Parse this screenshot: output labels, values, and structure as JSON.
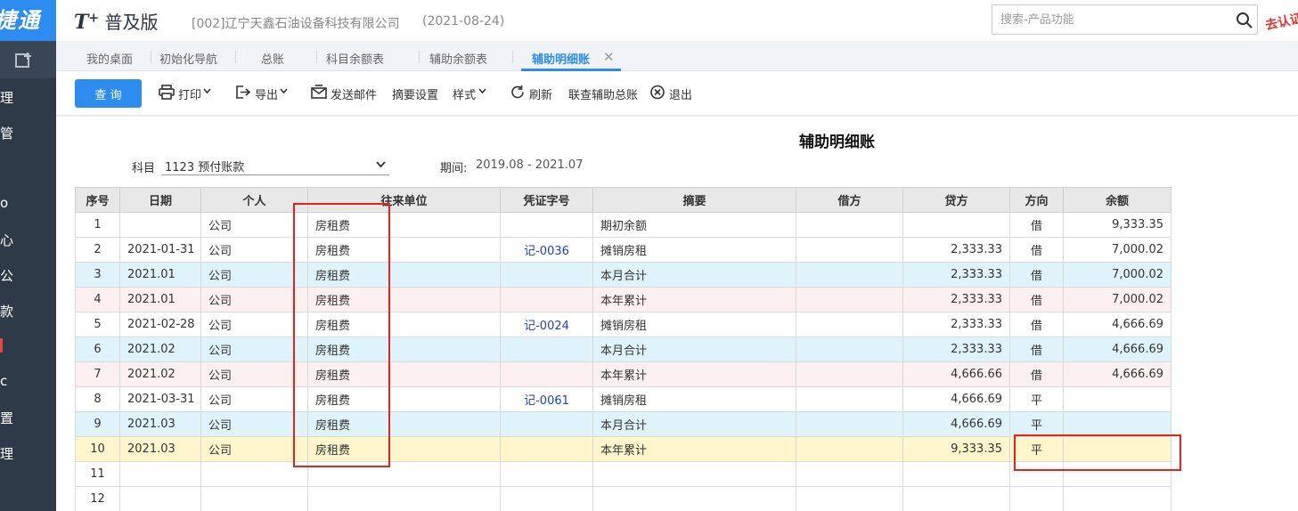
{
  "sidebar": {
    "brand": "捷通",
    "items": [
      "理",
      "管",
      "o",
      "心",
      "公",
      "款",
      "c",
      "置",
      "理"
    ],
    "marker_color": "#e84a3a"
  },
  "header": {
    "logo_mark": "T",
    "logo_plus": "+",
    "logo_text": "普及版",
    "company": "[002]辽宁天鑫石油设备科技有限公司",
    "date": "(2021-08-24)",
    "search_placeholder": "搜索-产品功能",
    "verify_text": "去认证"
  },
  "tabs": [
    {
      "label": "我的桌面",
      "active": false
    },
    {
      "label": "初始化导航",
      "active": false
    },
    {
      "label": "总账",
      "active": false
    },
    {
      "label": "科目余额表",
      "active": false
    },
    {
      "label": "辅助余额表",
      "active": false
    },
    {
      "label": "辅助明细账",
      "active": true
    }
  ],
  "toolbar": {
    "query": "查 询",
    "print": "打印",
    "export": "导出",
    "send_mail": "发送邮件",
    "summary_settings": "摘要设置",
    "style": "样式",
    "refresh": "刷新",
    "linked_general": "联查辅助总账",
    "exit": "退出"
  },
  "report": {
    "title": "辅助明细账",
    "subject_label": "科目",
    "subject_value": "1123 预付账款",
    "period_label": "期间:",
    "period_value": "2019.08 - 2021.07"
  },
  "table": {
    "columns": [
      "序号",
      "日期",
      "个人",
      "往来单位",
      "凭证字号",
      "摘要",
      "借方",
      "贷方",
      "方向",
      "余额"
    ],
    "rows": [
      {
        "no": "1",
        "date": "",
        "person": "公司",
        "unit": "房租费",
        "voucher": "",
        "summary": "期初余额",
        "debit": "",
        "credit": "",
        "dir": "借",
        "balance": "9,333.35",
        "style": "plain"
      },
      {
        "no": "2",
        "date": "2021-01-31",
        "person": "公司",
        "unit": "房租费",
        "voucher": "记-0036",
        "summary": "摊销房租",
        "debit": "",
        "credit": "2,333.33",
        "dir": "借",
        "balance": "7,000.02",
        "style": "plain"
      },
      {
        "no": "3",
        "date": "2021.01",
        "person": "公司",
        "unit": "房租费",
        "voucher": "",
        "summary": "本月合计",
        "debit": "",
        "credit": "2,333.33",
        "dir": "借",
        "balance": "7,000.02",
        "style": "blue"
      },
      {
        "no": "4",
        "date": "2021.01",
        "person": "公司",
        "unit": "房租费",
        "voucher": "",
        "summary": "本年累计",
        "debit": "",
        "credit": "2,333.33",
        "dir": "借",
        "balance": "7,000.02",
        "style": "pink"
      },
      {
        "no": "5",
        "date": "2021-02-28",
        "person": "公司",
        "unit": "房租费",
        "voucher": "记-0024",
        "summary": "摊销房租",
        "debit": "",
        "credit": "2,333.33",
        "dir": "借",
        "balance": "4,666.69",
        "style": "plain"
      },
      {
        "no": "6",
        "date": "2021.02",
        "person": "公司",
        "unit": "房租费",
        "voucher": "",
        "summary": "本月合计",
        "debit": "",
        "credit": "2,333.33",
        "dir": "借",
        "balance": "4,666.69",
        "style": "blue"
      },
      {
        "no": "7",
        "date": "2021.02",
        "person": "公司",
        "unit": "房租费",
        "voucher": "",
        "summary": "本年累计",
        "debit": "",
        "credit": "4,666.66",
        "dir": "借",
        "balance": "4,666.69",
        "style": "pink"
      },
      {
        "no": "8",
        "date": "2021-03-31",
        "person": "公司",
        "unit": "房租费",
        "voucher": "记-0061",
        "summary": "摊销房租",
        "debit": "",
        "credit": "4,666.69",
        "dir": "平",
        "balance": "",
        "style": "plain"
      },
      {
        "no": "9",
        "date": "2021.03",
        "person": "公司",
        "unit": "房租费",
        "voucher": "",
        "summary": "本月合计",
        "debit": "",
        "credit": "4,666.69",
        "dir": "平",
        "balance": "",
        "style": "blue"
      },
      {
        "no": "10",
        "date": "2021.03",
        "person": "公司",
        "unit": "房租费",
        "voucher": "",
        "summary": "本年累计",
        "debit": "",
        "credit": "9,333.35",
        "dir": "平",
        "balance": "",
        "style": "yellow"
      },
      {
        "no": "11",
        "date": "",
        "person": "",
        "unit": "",
        "voucher": "",
        "summary": "",
        "debit": "",
        "credit": "",
        "dir": "",
        "balance": "",
        "style": "plain"
      },
      {
        "no": "12",
        "date": "",
        "person": "",
        "unit": "",
        "voucher": "",
        "summary": "",
        "debit": "",
        "credit": "",
        "dir": "",
        "balance": "",
        "style": "plain"
      }
    ]
  },
  "colors": {
    "primary": "#2d8cf0",
    "sidebar": "#2f3a48",
    "annotation_red": "#e4231b",
    "voucher_link": "#1e3fbf"
  }
}
